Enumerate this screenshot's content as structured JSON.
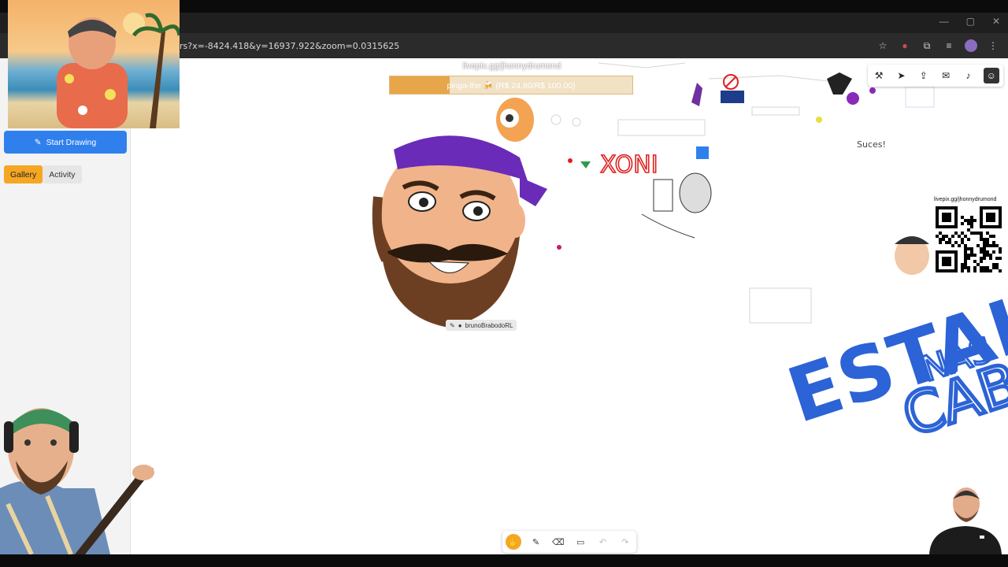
{
  "browser": {
    "url": "rs?x=-8424.418&y=16937.922&zoom=0.0315625",
    "icons": [
      "star-icon",
      "extension-icon",
      "puzzle-icon",
      "playlist-icon",
      "profile-icon",
      "menu-icon"
    ]
  },
  "sidebar": {
    "start_drawing": "Start Drawing",
    "tabs": [
      {
        "label": "Gallery",
        "active": true
      },
      {
        "label": "Activity",
        "active": false
      }
    ]
  },
  "overlay": {
    "livepix_url": "livepix.gg/jhonnydrumond",
    "goal_text": "pinga-lhe 🍻 (R$ 24,80/R$ 100,00)",
    "goal_progress": 0.248,
    "qr_label": "livepix.gg/jhonnydrumond"
  },
  "canvas": {
    "user_tag": "brunoBrabodoRL",
    "texts": {
      "xoni": "XONI",
      "estai": "ESTAI",
      "nas": "NAS",
      "cabeca": "CABEÇ",
      "sucesso": "Suces!"
    }
  },
  "draw_toolbar": {
    "icons": [
      "wrench-icon",
      "cursor-icon",
      "share-icon",
      "chat-icon",
      "bell-icon",
      "user-icon"
    ]
  },
  "bottom_toolbar": {
    "tools": [
      {
        "name": "hand-tool",
        "glyph": "✋",
        "state": "active"
      },
      {
        "name": "pen-tool",
        "glyph": "✎",
        "state": "normal"
      },
      {
        "name": "eraser-tool",
        "glyph": "⌫",
        "state": "normal"
      },
      {
        "name": "rect-tool",
        "glyph": "▭",
        "state": "normal"
      },
      {
        "name": "undo-tool",
        "glyph": "↶",
        "state": "disabled"
      },
      {
        "name": "redo-tool",
        "glyph": "↷",
        "state": "disabled"
      }
    ]
  },
  "colors": {
    "accent": "#2f80ed",
    "tab_active": "#f5a623",
    "estai_blue": "#2c63d6",
    "bandana_purple": "#6a2bb8"
  }
}
